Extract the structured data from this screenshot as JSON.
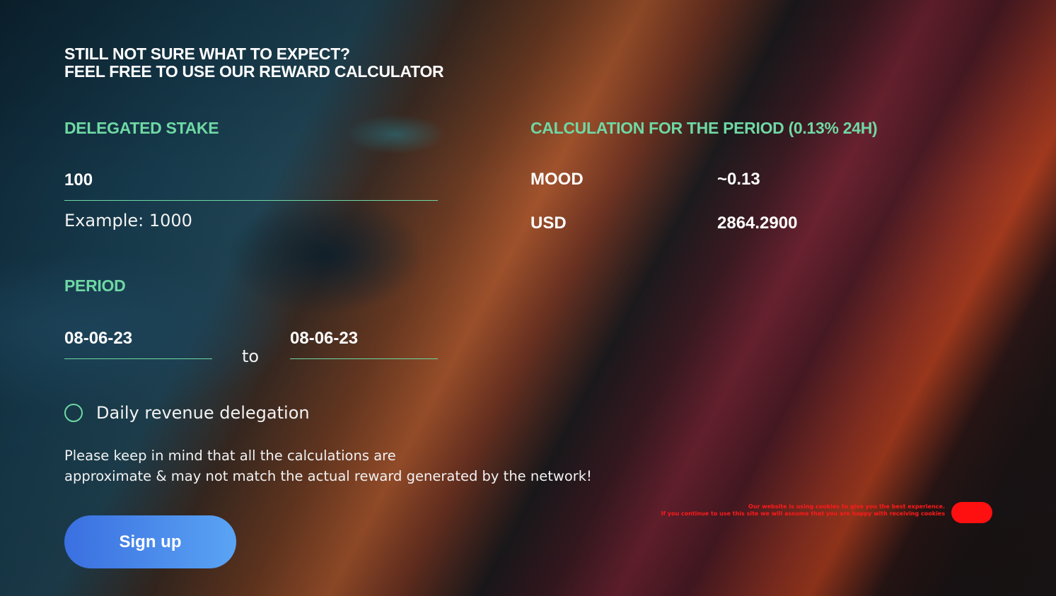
{
  "heading": {
    "line1": "STILL NOT SURE WHAT TO EXPECT?",
    "line2": "FEEL FREE TO USE OUR REWARD CALCULATOR"
  },
  "stake": {
    "label": "DELEGATED STAKE",
    "value": "100",
    "hint": "Example: 1000"
  },
  "period": {
    "label": "PERIOD",
    "from": "08-06-23",
    "separator": "to",
    "to": "08-06-23"
  },
  "daily_delegation": {
    "label": "Daily revenue delegation",
    "checked": false
  },
  "disclaimer": {
    "line1": "Please keep in mind that all the calculations are",
    "line2": "approximate & may not match the actual reward generated by the network!"
  },
  "signup_button": "Sign up",
  "calculation": {
    "label": "CALCULATION FOR THE PERIOD (0.13% 24H)",
    "rows": [
      {
        "label": "MOOD",
        "value": "~0.13"
      },
      {
        "label": "USD",
        "value": "2864.2900"
      }
    ]
  },
  "cookie_notice": {
    "line1": "Our website is using cookies to give you the best experience.",
    "line2": "If you continue to use this site we will assume that you are happy with receiving cookies"
  },
  "colors": {
    "accent_green": "#6fd8a4",
    "button_gradient_start": "#3a6fe0",
    "button_gradient_end": "#5aa4f4",
    "cookie_red": "#ff1010"
  }
}
